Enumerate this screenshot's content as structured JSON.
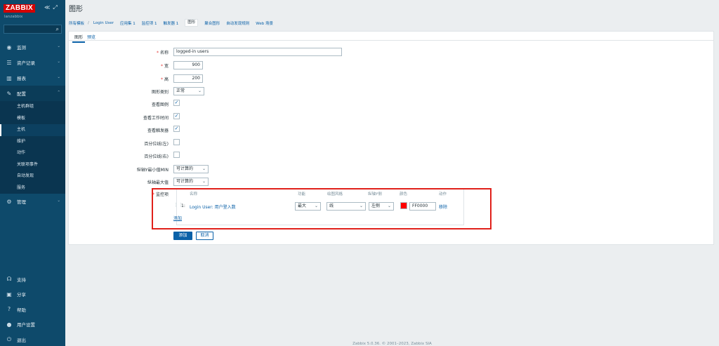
{
  "app": {
    "logo": "ZABBIX",
    "subtitle": "lanzabbix",
    "collapse_icons": [
      "≪",
      "⤢"
    ]
  },
  "sidebar": {
    "menu": [
      {
        "label": "监测",
        "icon": "eye-icon"
      },
      {
        "label": "资产记录",
        "icon": "list-icon"
      },
      {
        "label": "报表",
        "icon": "chart-icon"
      },
      {
        "label": "配置",
        "icon": "wrench-icon"
      },
      {
        "label": "管理",
        "icon": "gear-icon"
      }
    ],
    "submenu": [
      "主机群组",
      "模板",
      "主机",
      "维护",
      "动作",
      "关联项事件",
      "自动发现",
      "服务"
    ],
    "bottom": [
      {
        "label": "支持",
        "icon": "headset-icon"
      },
      {
        "label": "分享",
        "icon": "share-icon"
      },
      {
        "label": "帮助",
        "icon": "help-icon"
      },
      {
        "label": "用户设置",
        "icon": "user-icon"
      },
      {
        "label": "退出",
        "icon": "power-icon"
      }
    ]
  },
  "page": {
    "title": "图形"
  },
  "breadcrumb": {
    "items": [
      "所有模板",
      "Login User",
      "应用集 1",
      "监控项 1",
      "触发器 1",
      "图形",
      "聚合图形",
      "自动发现规则",
      "Web 场景"
    ]
  },
  "tabs": [
    "图形",
    "预览"
  ],
  "form": {
    "name_label": "名称",
    "name_value": "logged-in users",
    "width_label": "宽",
    "width_value": "900",
    "height_label": "高",
    "height_value": "200",
    "graph_type_label": "图形类别",
    "graph_type_value": "正常",
    "show_legend_label": "查看图例",
    "show_working_time_label": "查看工作时间",
    "show_triggers_label": "查看触发器",
    "percentile_left_label": "百分位线(左)",
    "percentile_right_label": "百分位线(右)",
    "ymin_label": "纵轴Y最小值MIN",
    "ymin_value": "可计算的",
    "ymax_label": "纵轴最大值",
    "ymax_value": "可计算的",
    "items_label": "监控项"
  },
  "items_table": {
    "headers": [
      "名称",
      "功能",
      "绘图风格",
      "纵轴Y侧",
      "颜色",
      "动作"
    ],
    "rows": [
      {
        "index": "1:",
        "name": "Login User: 用户登入数",
        "function": "最大",
        "draw_style": "线",
        "y_axis_side": "左侧",
        "color": "FF0000",
        "action": "移除"
      }
    ],
    "add_link": "添加"
  },
  "buttons": {
    "add": "添加",
    "cancel": "取消"
  },
  "footer": "Zabbix 5.0.36. © 2001–2023, Zabbix SIA",
  "colors": {
    "sidebar_bg": "#0e4a6b",
    "logo_red": "#d40000",
    "accent": "#0a61a8",
    "item_color": "#FF0000",
    "highlight_border": "#e0201b"
  }
}
